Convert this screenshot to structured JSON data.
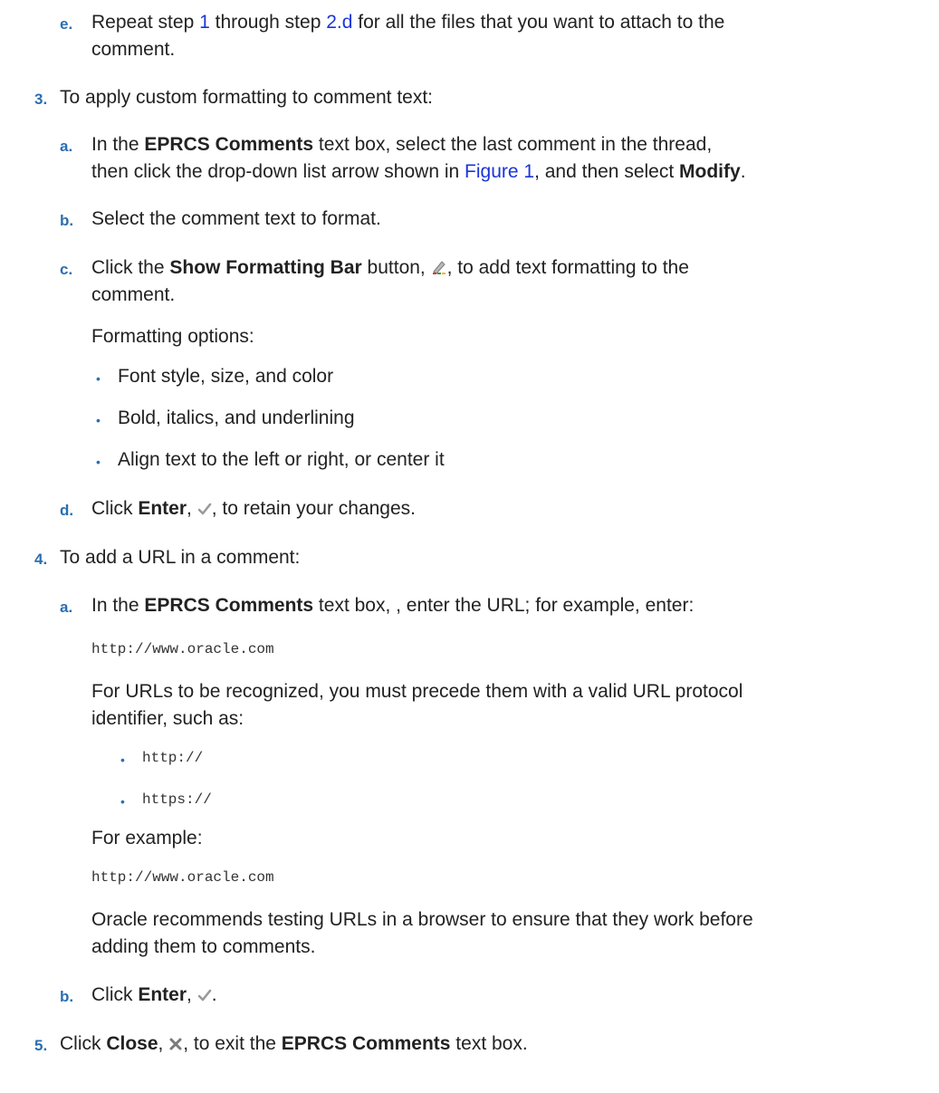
{
  "step_e": {
    "marker": "e.",
    "t1": "Repeat step ",
    "link1": "1",
    "t2": " through step ",
    "link2": "2.d",
    "t3": " for all the files that you want to attach to the",
    "line2": "comment."
  },
  "step3": {
    "marker": "3.",
    "text": "To apply custom formatting to comment text:",
    "a": {
      "marker": "a.",
      "t1": "In the ",
      "b1": "EPRCS Comments",
      "t2": " text box, select the last comment in the thread,",
      "t3": "then click the drop-down list arrow shown in ",
      "link": "Figure 1",
      "t4": ", and then select ",
      "b2": "Modify",
      "t5": "."
    },
    "b": {
      "marker": "b.",
      "text": "Select the comment text to format."
    },
    "c": {
      "marker": "c.",
      "t1": "Click the ",
      "b1": "Show Formatting Bar",
      "t2": " button, ",
      "t3": ", to add text formatting to the",
      "line2": "comment.",
      "options_label": "Formatting options:",
      "options": [
        "Font style, size, and color",
        "Bold, italics, and underlining",
        "Align text to the left or right, or center it"
      ]
    },
    "d": {
      "marker": "d.",
      "t1": "Click ",
      "b1": "Enter",
      "t2": ", ",
      "t3": ", to retain your changes."
    }
  },
  "step4": {
    "marker": "4.",
    "text": "To add a URL in a comment:",
    "a": {
      "marker": "a.",
      "t1": "In the ",
      "b1": "EPRCS Comments",
      "t2": " text box, , enter the URL; for example, enter:",
      "code1": "http://www.oracle.com",
      "p1_line1": "For URLs to be recognized, you must precede them with a valid URL protocol",
      "p1_line2": "identifier, such as:",
      "protocols": [
        "http://",
        "https://"
      ],
      "for_example": "For example:",
      "code2": "http://www.oracle.com",
      "p2_line1": "Oracle recommends testing URLs in a browser to ensure that they work before",
      "p2_line2": "adding them to comments."
    },
    "b": {
      "marker": "b.",
      "t1": "Click ",
      "b1": "Enter",
      "t2": ", ",
      "t3": "."
    }
  },
  "step5": {
    "marker": "5.",
    "t1": "Click ",
    "b1": "Close",
    "t2": ", ",
    "t3": ", to exit the ",
    "b2": "EPRCS Comments",
    "t4": " text box."
  },
  "colors": {
    "marker": "#2a6eb1",
    "link": "#1a35d8",
    "text": "#222222"
  },
  "icons": [
    "pencil-formatting-icon",
    "checkmark-icon",
    "close-x-icon"
  ]
}
